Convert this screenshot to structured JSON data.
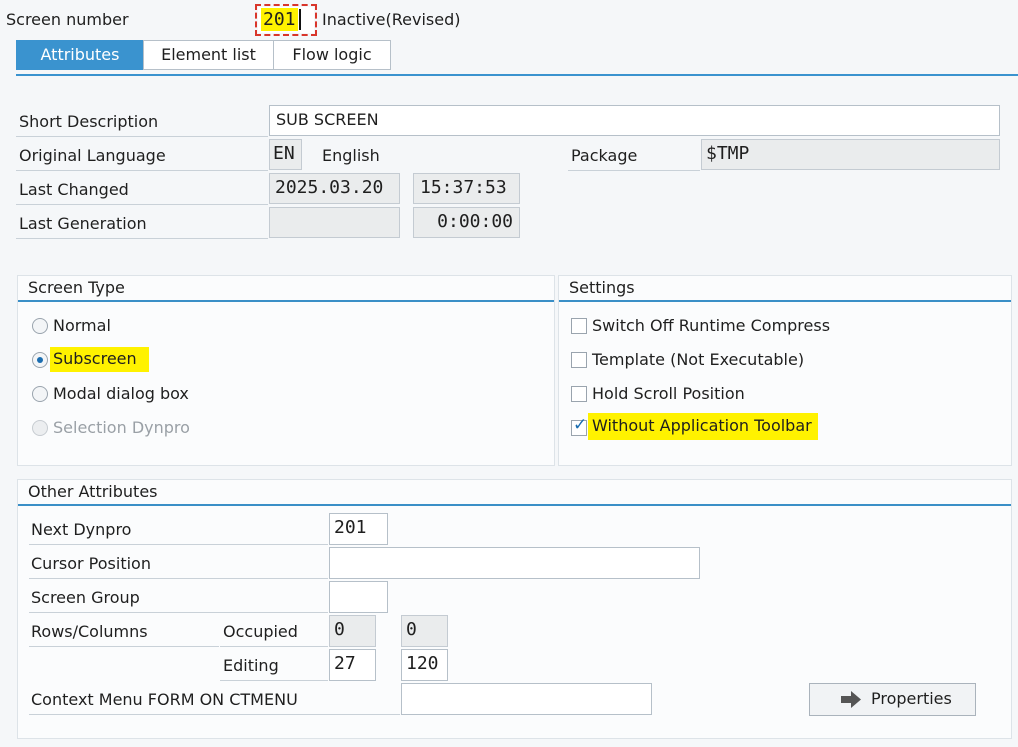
{
  "header": {
    "screen_number_label": "Screen number",
    "screen_number_value": "201",
    "status": "Inactive(Revised)"
  },
  "tabs": [
    {
      "label": "Attributes",
      "active": true
    },
    {
      "label": "Element list",
      "active": false
    },
    {
      "label": "Flow logic",
      "active": false
    }
  ],
  "general": {
    "short_description_label": "Short Description",
    "short_description_value": "SUB SCREEN",
    "original_language_label": "Original Language",
    "language_code": "EN",
    "language_name": "English",
    "package_label": "Package",
    "package_value": "$TMP",
    "last_changed_label": "Last Changed",
    "last_changed_date": "2025.03.20",
    "last_changed_time": "15:37:53",
    "last_generation_label": "Last Generation",
    "last_generation_date": "",
    "last_generation_time": "0:00:00"
  },
  "screen_type": {
    "title": "Screen Type",
    "options": [
      {
        "label": "Normal",
        "selected": false,
        "enabled": true
      },
      {
        "label": "Subscreen",
        "selected": true,
        "enabled": true
      },
      {
        "label": "Modal dialog box",
        "selected": false,
        "enabled": true
      },
      {
        "label": "Selection Dynpro",
        "selected": false,
        "enabled": false
      }
    ]
  },
  "settings": {
    "title": "Settings",
    "options": [
      {
        "label": "Switch Off Runtime Compress",
        "checked": false
      },
      {
        "label": "Template (Not Executable)",
        "checked": false
      },
      {
        "label": "Hold Scroll Position",
        "checked": false
      },
      {
        "label": "Without Application Toolbar",
        "checked": true
      }
    ]
  },
  "other_attributes": {
    "title": "Other Attributes",
    "next_dynpro_label": "Next Dynpro",
    "next_dynpro_value": "201",
    "cursor_position_label": "Cursor Position",
    "cursor_position_value": "",
    "screen_group_label": "Screen Group",
    "screen_group_value": "",
    "rows_columns_label": "Rows/Columns",
    "occupied_label": "Occupied",
    "occupied_rows": "0",
    "occupied_columns": "0",
    "editing_label": "Editing",
    "editing_rows": "27",
    "editing_columns": "120",
    "context_menu_label": "Context Menu FORM ON CTMENU",
    "context_menu_value": "",
    "properties_button": "Properties"
  },
  "colors": {
    "accent": "#3a93cf",
    "highlight": "#fff200",
    "focus_border": "#d9362b"
  },
  "icons": {
    "properties_button_icon": "arrow-right-icon"
  }
}
